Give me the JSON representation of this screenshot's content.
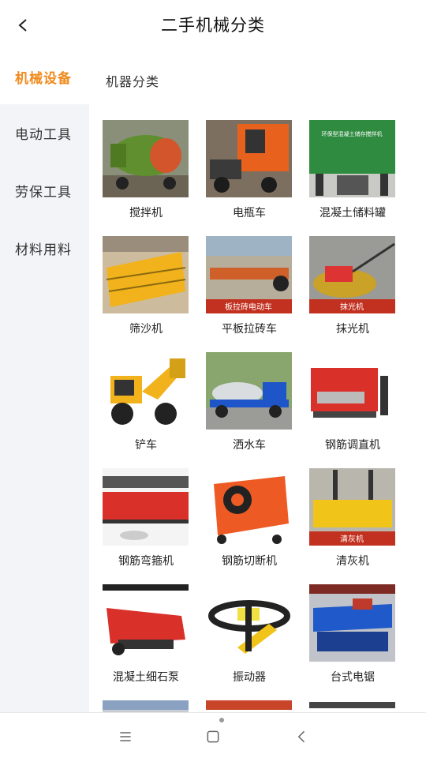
{
  "header": {
    "title": "二手机械分类"
  },
  "sidebar": {
    "items": [
      {
        "label": "机械设备",
        "active": true
      },
      {
        "label": "电动工具",
        "active": false
      },
      {
        "label": "劳保工具",
        "active": false
      },
      {
        "label": "材料用料",
        "active": false
      }
    ]
  },
  "main": {
    "section_title": "机器分类",
    "items": [
      {
        "label": "搅拌机",
        "img_text": ""
      },
      {
        "label": "电瓶车",
        "img_text": ""
      },
      {
        "label": "混凝土储料罐",
        "img_text": "环保型混凝土储存搅拌机"
      },
      {
        "label": "筛沙机",
        "img_text": ""
      },
      {
        "label": "平板拉砖车",
        "img_text": "板拉砖电动车"
      },
      {
        "label": "抹光机",
        "img_text": "抹光机"
      },
      {
        "label": "铲车",
        "img_text": ""
      },
      {
        "label": "洒水车",
        "img_text": ""
      },
      {
        "label": "钢筋调直机",
        "img_text": ""
      },
      {
        "label": "钢筋弯箍机",
        "img_text": ""
      },
      {
        "label": "钢筋切断机",
        "img_text": ""
      },
      {
        "label": "清灰机",
        "img_text": "清灰机"
      },
      {
        "label": "混凝土细石泵",
        "img_text": ""
      },
      {
        "label": "振动器",
        "img_text": ""
      },
      {
        "label": "台式电锯",
        "img_text": ""
      }
    ]
  },
  "colors": {
    "accent": "#f08a1c",
    "sidebar_bg": "#f2f4f7"
  },
  "icons": {
    "back": "chevron-left-icon",
    "menu": "menu-icon",
    "home": "home-icon",
    "nav_back": "nav-back-icon"
  }
}
